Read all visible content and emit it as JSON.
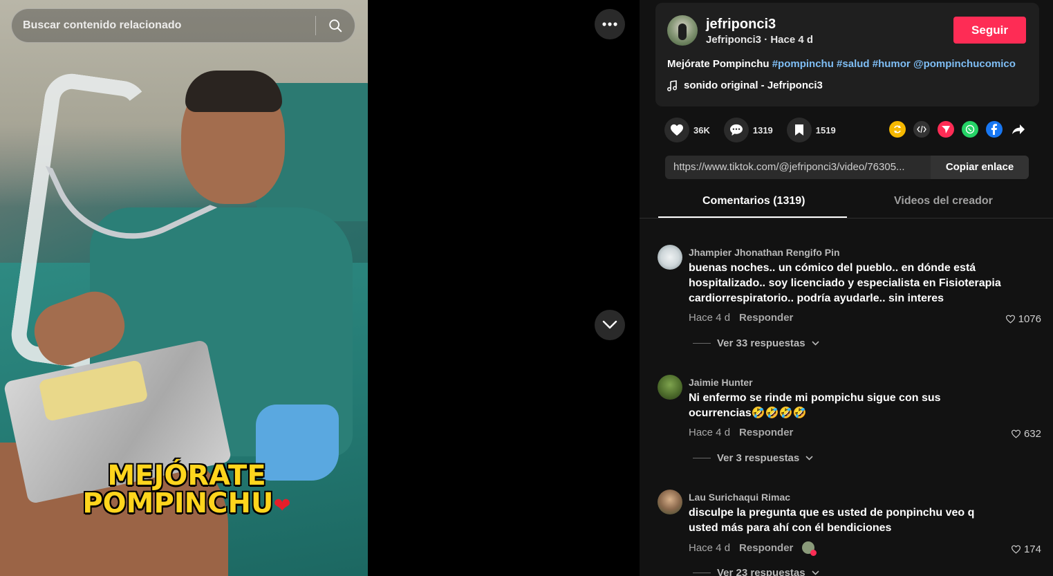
{
  "video": {
    "search_placeholder": "Buscar contenido relacionado",
    "overlay_line1": "MEJÓRATE",
    "overlay_line2": "POMPINCHU",
    "overlay_emoji": "❤"
  },
  "post": {
    "username": "jefriponci3",
    "subline": "Jefriponci3 · Hace 4 d",
    "follow_label": "Seguir",
    "description_text": "Mejórate Pompinchu",
    "hashtags": [
      "#pompinchu",
      "#salud",
      "#humor",
      "@pompinchucomico"
    ],
    "music": "sonido original - Jefriponci3"
  },
  "actions": {
    "likes": "36K",
    "comments": "1319",
    "saves": "1519"
  },
  "share_icons": [
    "repost-icon",
    "embed-icon",
    "send-icon",
    "whatsapp-icon",
    "facebook-icon",
    "share-arrow-icon"
  ],
  "link": {
    "url": "https://www.tiktok.com/@jefriponci3/video/76305...",
    "copy_label": "Copiar enlace"
  },
  "tabs": {
    "comments": "Comentarios (1319)",
    "creator_videos": "Videos del creador"
  },
  "comments": [
    {
      "name": "Jhampier Jhonathan Rengifo Pin",
      "text": "buenas noches.. un cómico del pueblo.. en dónde está hospitalizado.. soy licenciado y especialista en Fisioterapia cardiorrespiratorio.. podría ayudarle.. sin interes",
      "time": "Hace 4 d",
      "reply": "Responder",
      "likes": "1076",
      "replies": "Ver 33 respuestas"
    },
    {
      "name": "Jaimie Hunter",
      "text": "Ni enfermo se rinde mi pompichu sigue con sus ocurrencias🤣🤣🤣🤣",
      "time": "Hace 4 d",
      "reply": "Responder",
      "likes": "632",
      "replies": "Ver 3 respuestas"
    },
    {
      "name": "Lau Surichaqui Rimac",
      "text": "disculpe la pregunta que es usted de ponpinchu veo q usted más para ahí con él bendiciones",
      "time": "Hace 4 d",
      "reply": "Responder",
      "likes": "174",
      "replies": "Ver 23 respuestas"
    }
  ],
  "colors": {
    "follow": "#fe2c55",
    "hashtag": "#7fbef5",
    "overlay_text": "#ffd51d"
  }
}
